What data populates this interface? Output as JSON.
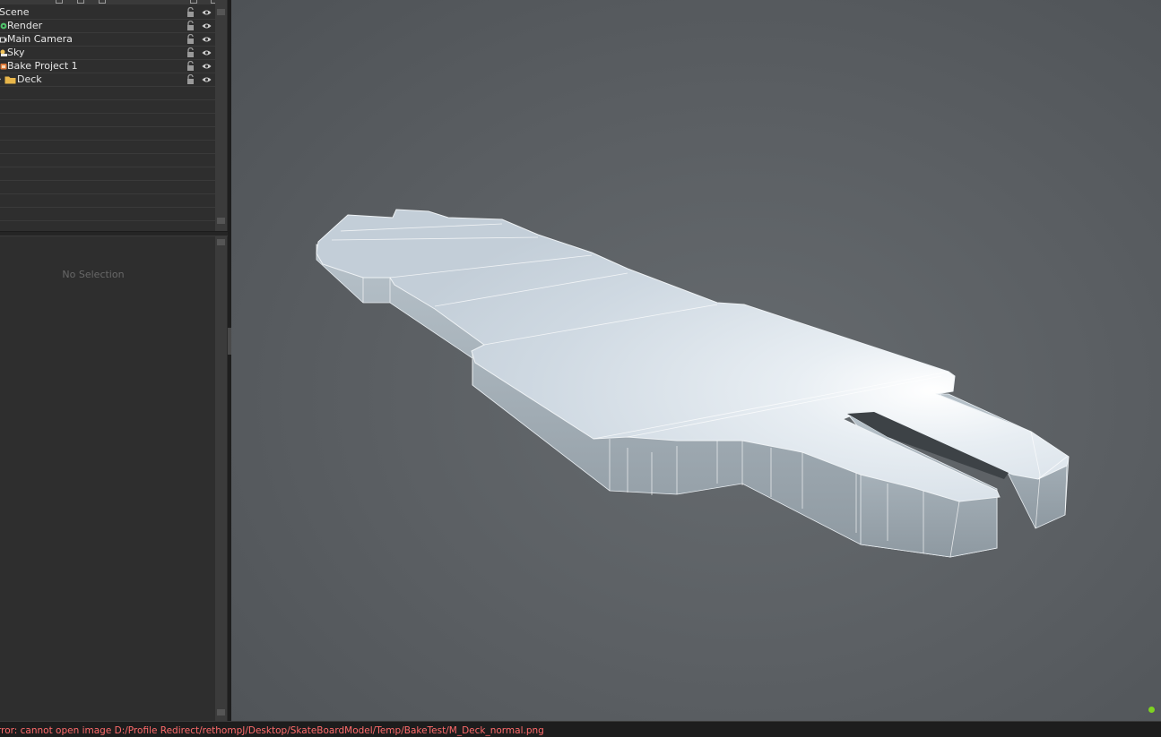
{
  "outliner": {
    "items": [
      {
        "label": "Scene",
        "icon": "scene-icon"
      },
      {
        "label": "Render",
        "icon": "render-icon"
      },
      {
        "label": "Main Camera",
        "icon": "camera-icon"
      },
      {
        "label": "Sky",
        "icon": "sky-icon"
      },
      {
        "label": "Bake Project 1",
        "icon": "bake-project-icon"
      },
      {
        "label": "Deck",
        "icon": "folder-icon"
      }
    ]
  },
  "properties": {
    "empty_text": "No Selection"
  },
  "status_bar": {
    "message": "rror: cannot open image D:/Profile Redirect/rethompJ/Desktop/SkateBoardModel/Temp/BakeTest/M_Deck_normal.png"
  },
  "colors": {
    "accent_green": "#7ed321",
    "error_text": "#ff6b6b",
    "mesh_top": "#dde6ee",
    "mesh_side": "#9aa5ad"
  }
}
